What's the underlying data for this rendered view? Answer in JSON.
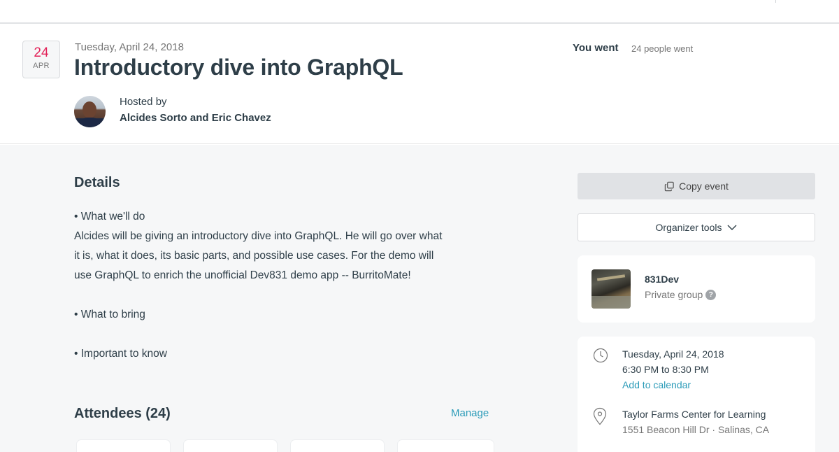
{
  "event": {
    "day": "24",
    "month": "APR",
    "date_long": "Tuesday, April 24, 2018",
    "title": "Introductory dive into GraphQL"
  },
  "host": {
    "label": "Hosted by",
    "names": "Alcides Sorto and Eric Chavez"
  },
  "rsvp": {
    "status": "You went",
    "count_text": "24 people went"
  },
  "details": {
    "heading": "Details",
    "what_we_do": "• What we'll do",
    "description_lines": [
      "Alcides will be giving an introductory dive into GraphQL. He will go over what",
      "it is, what it does, its basic parts, and possible use cases. For the demo will",
      "use GraphQL to enrich the unofficial Dev831 demo app -- BurritoMate!"
    ],
    "what_to_bring": "• What to bring",
    "important": "• Important to know"
  },
  "attendees": {
    "heading": "Attendees (24)",
    "manage_label": "Manage"
  },
  "sidebar": {
    "copy_label": "Copy event",
    "organizer_label": "Organizer tools",
    "group": {
      "name": "831Dev",
      "type": "Private group",
      "help_glyph": "?"
    },
    "when": {
      "date": "Tuesday, April 24, 2018",
      "time": "6:30 PM to 8:30 PM",
      "add_calendar": "Add to calendar"
    },
    "where": {
      "venue": "Taylor Farms Center for Learning",
      "address": "1551 Beacon Hill Dr · Salinas, CA"
    }
  },
  "colors": {
    "accent_link": "#2b9bb8",
    "date_red": "#e32359",
    "text_primary": "#2e3e48",
    "text_muted": "#757575",
    "page_bg": "#f6f7f8"
  }
}
